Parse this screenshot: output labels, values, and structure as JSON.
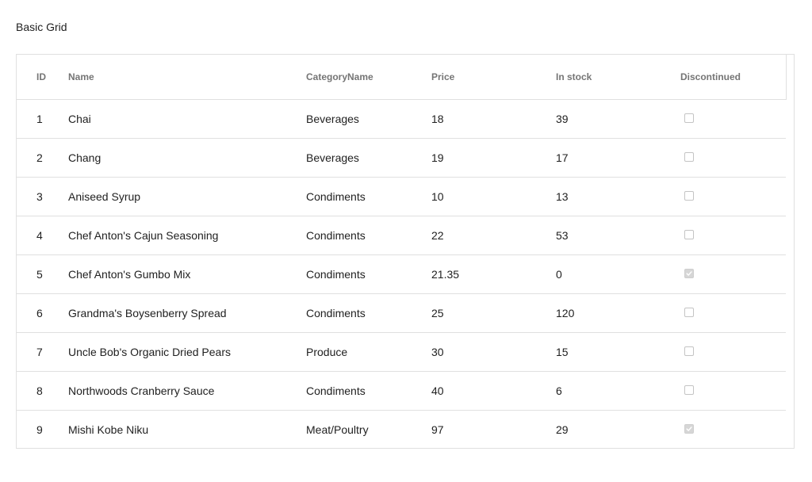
{
  "page": {
    "title": "Basic Grid"
  },
  "grid": {
    "columns": [
      {
        "key": "id",
        "label": "ID"
      },
      {
        "key": "name",
        "label": "Name"
      },
      {
        "key": "category",
        "label": "CategoryName"
      },
      {
        "key": "price",
        "label": "Price"
      },
      {
        "key": "stock",
        "label": "In stock"
      },
      {
        "key": "discontinued",
        "label": "Discontinued"
      }
    ],
    "rows": [
      {
        "id": "1",
        "name": "Chai",
        "category": "Beverages",
        "price": "18",
        "stock": "39",
        "discontinued": false
      },
      {
        "id": "2",
        "name": "Chang",
        "category": "Beverages",
        "price": "19",
        "stock": "17",
        "discontinued": false
      },
      {
        "id": "3",
        "name": "Aniseed Syrup",
        "category": "Condiments",
        "price": "10",
        "stock": "13",
        "discontinued": false
      },
      {
        "id": "4",
        "name": "Chef Anton's Cajun Seasoning",
        "category": "Condiments",
        "price": "22",
        "stock": "53",
        "discontinued": false
      },
      {
        "id": "5",
        "name": "Chef Anton's Gumbo Mix",
        "category": "Condiments",
        "price": "21.35",
        "stock": "0",
        "discontinued": true
      },
      {
        "id": "6",
        "name": "Grandma's Boysenberry Spread",
        "category": "Condiments",
        "price": "25",
        "stock": "120",
        "discontinued": false
      },
      {
        "id": "7",
        "name": "Uncle Bob's Organic Dried Pears",
        "category": "Produce",
        "price": "30",
        "stock": "15",
        "discontinued": false
      },
      {
        "id": "8",
        "name": "Northwoods Cranberry Sauce",
        "category": "Condiments",
        "price": "40",
        "stock": "6",
        "discontinued": false
      },
      {
        "id": "9",
        "name": "Mishi Kobe Niku",
        "category": "Meat/Poultry",
        "price": "97",
        "stock": "29",
        "discontinued": true
      }
    ]
  }
}
